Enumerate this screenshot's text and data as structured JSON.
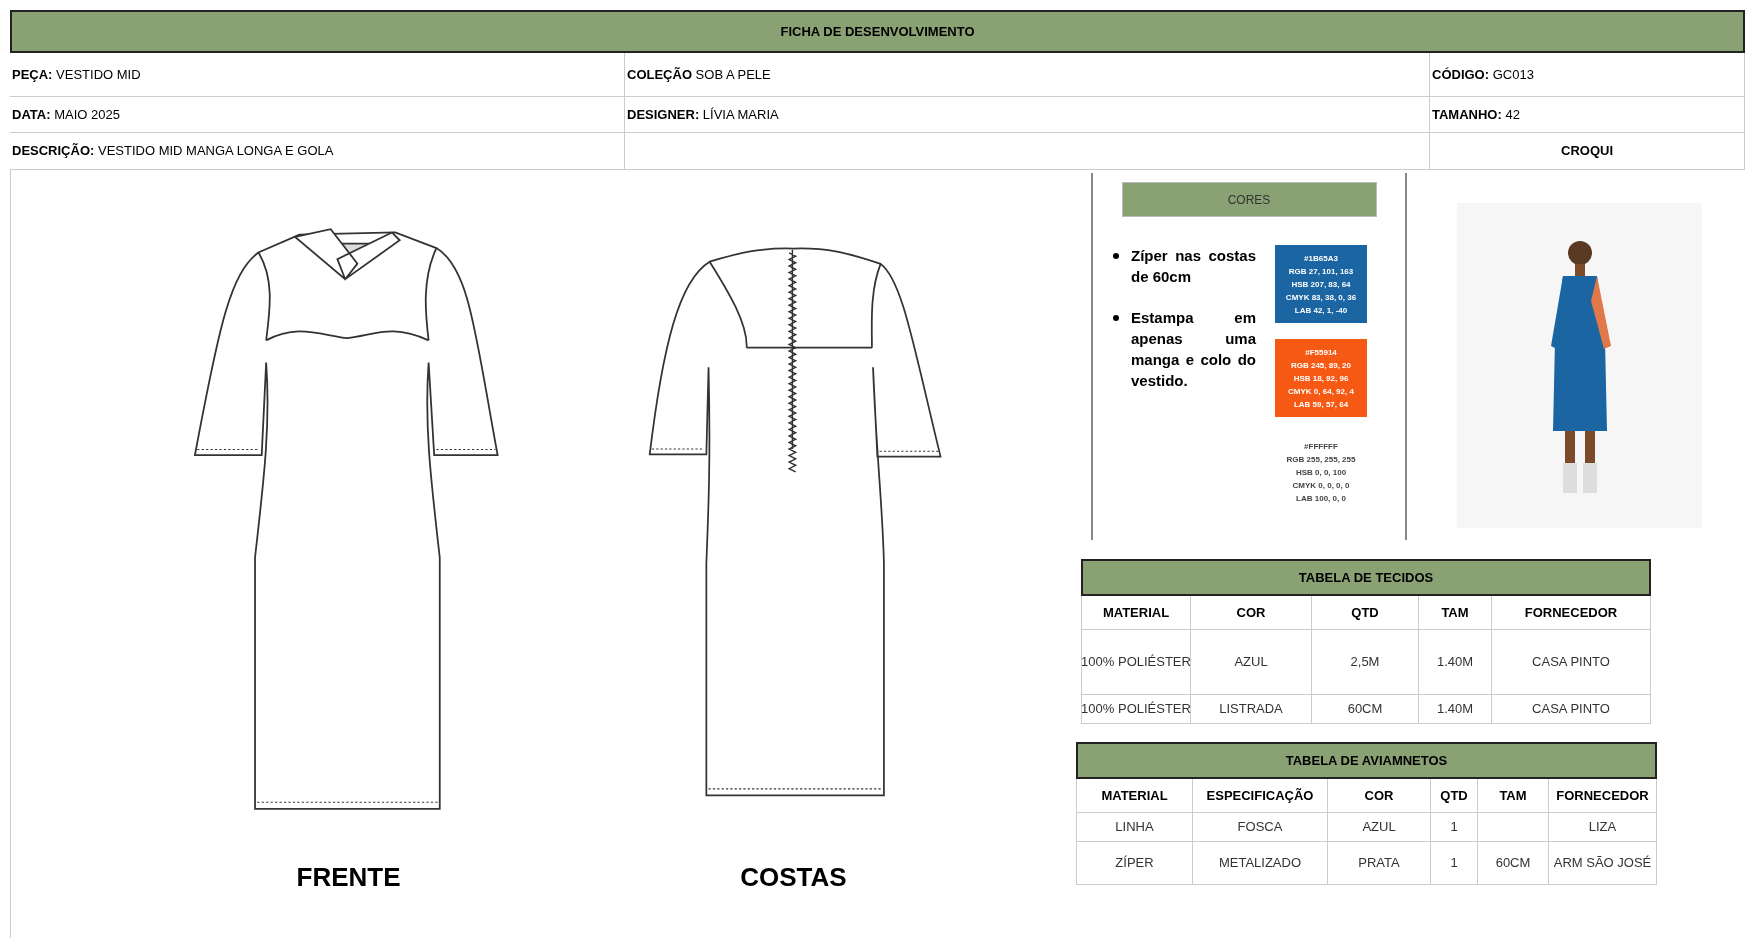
{
  "title": "FICHA DE DESENVOLVIMENTO",
  "info_rows": [
    [
      {
        "kind": "field",
        "label": "PEÇA:",
        "value": "VESTIDO MID"
      },
      {
        "kind": "field",
        "label": "COLEÇÃO",
        "value": "SOB A PELE"
      },
      {
        "kind": "field",
        "label": "CÓDIGO:",
        "value": "GC013"
      }
    ],
    [
      {
        "kind": "field",
        "label": "DATA:",
        "value": "MAIO 2025"
      },
      {
        "kind": "field",
        "label": "DESIGNER:",
        "value": "LÍVIA MARIA"
      },
      {
        "kind": "field",
        "label": "TAMANHO:",
        "value": "42"
      }
    ],
    [
      {
        "kind": "field",
        "label": "DESCRIÇÃO:",
        "value": "VESTIDO MID MANGA LONGA E GOLA"
      },
      {
        "kind": "empty"
      },
      {
        "kind": "heading",
        "text": "CROQUI"
      }
    ]
  ],
  "views": [
    {
      "kind": "front",
      "caption": "FRENTE"
    },
    {
      "kind": "back",
      "caption": "COSTAS"
    }
  ],
  "colors_panel": {
    "title": "CORES",
    "notes": [
      "Zíper nas costas de 60cm",
      "Estampa em apenas uma manga e colo do vestido."
    ],
    "swatches": [
      {
        "color": "#1b65a3",
        "lines": [
          "#1B65A3",
          "RGB 27, 101, 163",
          "HSB 207, 83, 64",
          "CMYK 83, 38, 0, 36",
          "LAB 42, 1, -40"
        ]
      },
      {
        "color": "#f55914",
        "lines": [
          "#F55914",
          "RGB 245, 89, 20",
          "HSB 18, 92, 96",
          "CMYK 0, 64, 92, 4",
          "LAB 59, 57, 64"
        ]
      },
      {
        "color": "#ffffff",
        "lines": [
          "#FFFFFF",
          "RGB 255, 255, 255",
          "HSB 0, 0, 100",
          "CMYK 0, 0, 0, 0",
          "LAB 100, 0, 0"
        ]
      }
    ]
  },
  "fabrics_table": {
    "title": "TABELA DE TECIDOS",
    "columns": [
      "MATERIAL",
      "COR",
      "QTD",
      "TAM",
      "FORNECEDOR"
    ],
    "rows": [
      [
        "100% POLIÉSTER",
        "AZUL",
        "2,5M",
        "1.40M",
        "CASA PINTO"
      ],
      [
        "100% POLIÉSTER",
        "LISTRADA",
        "60CM",
        "1.40M",
        "CASA PINTO"
      ]
    ]
  },
  "trims_table": {
    "title": "TABELA DE AVIAMNETOS",
    "columns": [
      "MATERIAL",
      "ESPECIFICAÇÃO",
      "COR",
      "QTD",
      "TAM",
      "FORNECEDOR"
    ],
    "rows": [
      [
        "LINHA",
        "FOSCA",
        "AZUL",
        "1",
        null,
        "LIZA"
      ],
      [
        "ZÍPER",
        "METALIZADO",
        "PRATA",
        "1",
        "60CM",
        "ARM SÃO JOSÉ"
      ]
    ]
  }
}
